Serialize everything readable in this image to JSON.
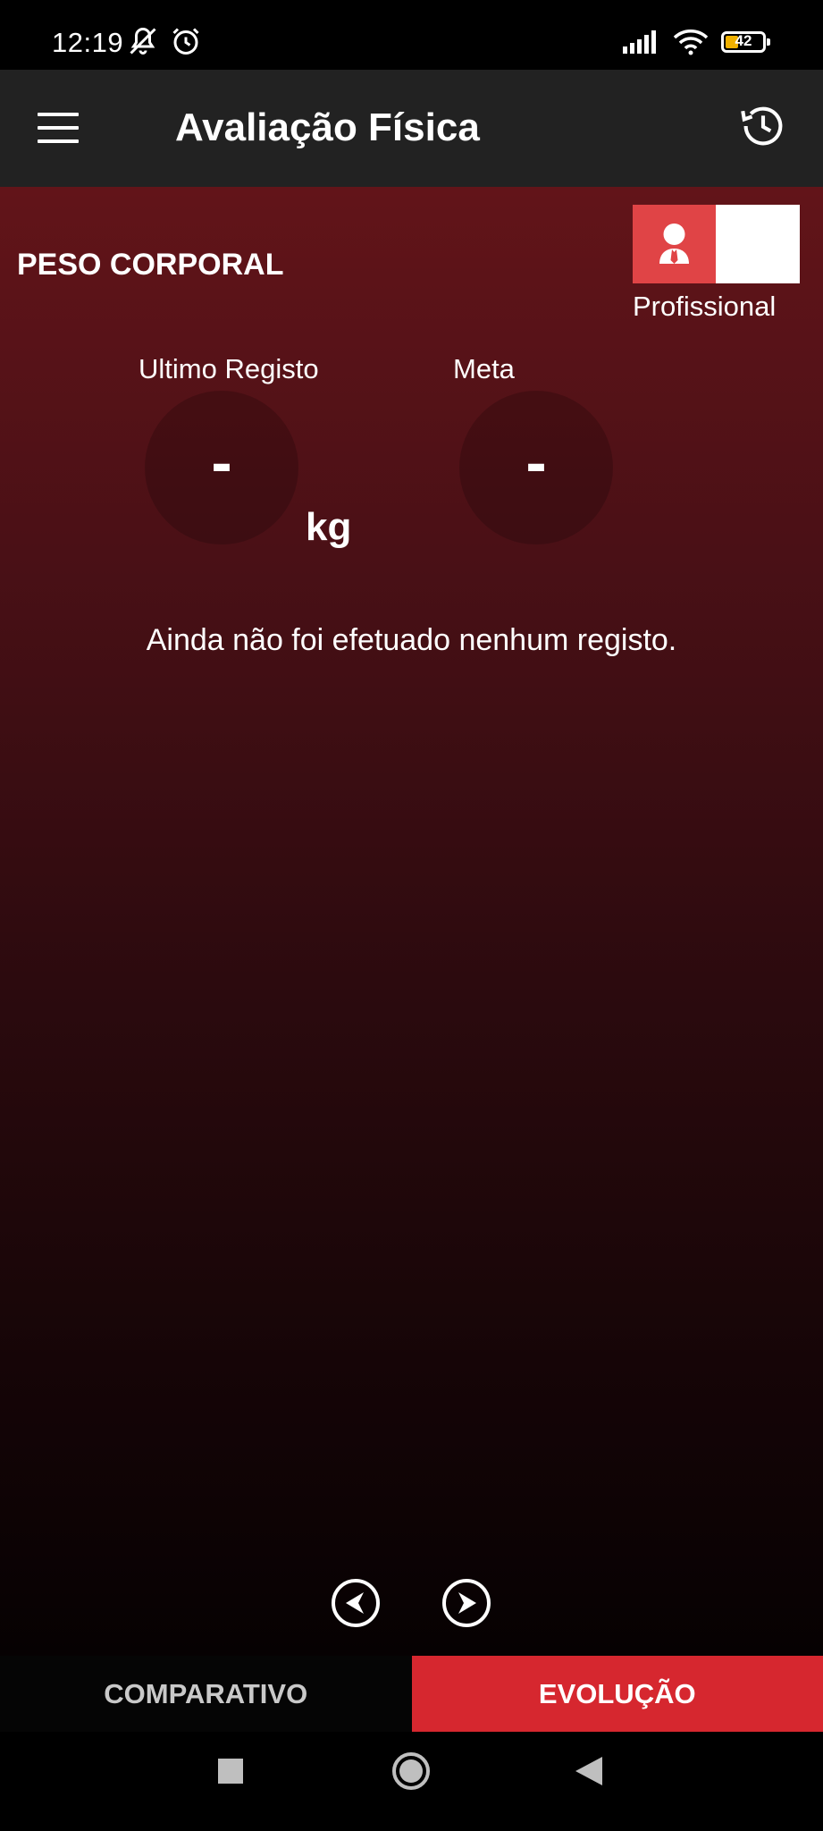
{
  "status_bar": {
    "time": "12:19",
    "battery": "42",
    "icons": [
      "bell-off-icon",
      "alarm-icon",
      "signal-icon",
      "wifi-icon",
      "battery-icon"
    ]
  },
  "app_bar": {
    "title": "Avaliação Física",
    "icons": [
      "menu-icon",
      "history-icon"
    ]
  },
  "main": {
    "section_title": "PESO CORPORAL",
    "toggle_label": "Profissional",
    "last_record_label": "Ultimo Registo",
    "last_record_value": "-",
    "goal_label": "Meta",
    "goal_value": "-",
    "unit": "kg",
    "empty_message": "Ainda não foi efetuado nenhum registo."
  },
  "tabs": {
    "comparativo": "COMPARATIVO",
    "evolucao": "EVOLUÇÃO",
    "active": "evolucao"
  },
  "colors": {
    "accent": "#d6272f",
    "toggle_red": "#e04446",
    "app_bar": "#222222",
    "gradient_top": "#621419",
    "gradient_bottom": "#060102"
  }
}
